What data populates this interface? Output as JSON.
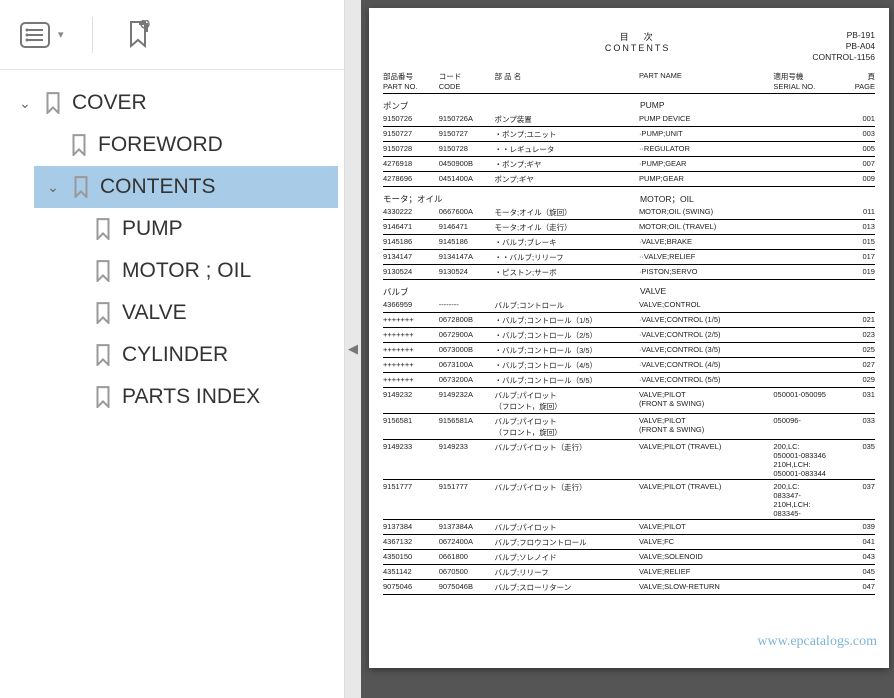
{
  "toolbar": {
    "outline_icon": "outline",
    "bookmark_icon": "bookmark-page"
  },
  "tree": {
    "root": {
      "label": "COVER"
    },
    "children": [
      {
        "label": "FOREWORD"
      },
      {
        "label": "CONTENTS",
        "selected": true,
        "children": [
          {
            "label": "PUMP"
          },
          {
            "label": "MOTOR ; OIL"
          },
          {
            "label": "VALVE"
          },
          {
            "label": "CYLINDER"
          },
          {
            "label": "PARTS INDEX"
          }
        ]
      }
    ]
  },
  "doc": {
    "title_jp": "目　次",
    "title_en": "CONTENTS",
    "codes": [
      "PB-191",
      "PB-A04",
      "CONTROL-1156"
    ],
    "headers": {
      "partno_jp": "部品番号",
      "partno_en": "PART NO.",
      "code_jp": "コード",
      "code_en": "CODE",
      "name_jp": "部 品 名",
      "name_en": "PART NAME",
      "serial_jp": "適用号機",
      "serial_en": "SERIAL NO.",
      "page_jp": "頁",
      "page_en": "PAGE"
    },
    "sections": [
      {
        "head_jp": "ポンプ",
        "head_en": "PUMP",
        "rows": [
          {
            "partno": "9150726",
            "code": "9150726A",
            "name_jp": "ポンプ装置",
            "name_en": "PUMP DEVICE",
            "serial": "",
            "page": "001"
          },
          {
            "partno": "9150727",
            "code": "9150727",
            "name_jp": "・ポンプ;ユニット",
            "name_en": "·PUMP;UNIT",
            "serial": "",
            "page": "003"
          },
          {
            "partno": "9150728",
            "code": "9150728",
            "name_jp": "・・レギュレータ",
            "name_en": "··REGULATOR",
            "serial": "",
            "page": "005"
          },
          {
            "partno": "4276918",
            "code": "0450900B",
            "name_jp": "・ポンプ;ギヤ",
            "name_en": "·PUMP;GEAR",
            "serial": "",
            "page": "007"
          },
          {
            "partno": "4278696",
            "code": "0451400A",
            "name_jp": "ポンプ;ギヤ",
            "name_en": "PUMP;GEAR",
            "serial": "",
            "page": "009"
          }
        ]
      },
      {
        "head_jp": "モータ；オイル",
        "head_en": "MOTOR；OIL",
        "rows": [
          {
            "partno": "4330222",
            "code": "0667600A",
            "name_jp": "モータ;オイル（旋回）",
            "name_en": "MOTOR;OIL (SWING)",
            "serial": "",
            "page": "011"
          },
          {
            "partno": "9146471",
            "code": "9146471",
            "name_jp": "モータ;オイル（走行）",
            "name_en": "MOTOR;OIL (TRAVEL)",
            "serial": "",
            "page": "013"
          },
          {
            "partno": "9145186",
            "code": "9145186",
            "name_jp": "・バルブ;ブレーキ",
            "name_en": "·VALVE;BRAKE",
            "serial": "",
            "page": "015"
          },
          {
            "partno": "9134147",
            "code": "9134147A",
            "name_jp": "・・バルブ;リリーフ",
            "name_en": "··VALVE;RELIEF",
            "serial": "",
            "page": "017"
          },
          {
            "partno": "9130524",
            "code": "9130524",
            "name_jp": "・ピストン;サーボ",
            "name_en": "·PISTON;SERVO",
            "serial": "",
            "page": "019"
          }
        ]
      },
      {
        "head_jp": "バルブ",
        "head_en": "VALVE",
        "rows": [
          {
            "partno": "4366959",
            "code": "--------",
            "name_jp": "バルブ;コントロール",
            "name_en": "VALVE;CONTROL",
            "serial": "",
            "page": ""
          },
          {
            "partno": "+++++++",
            "code": "0672800B",
            "name_jp": "・バルブ;コントロール（1/5）",
            "name_en": "·VALVE;CONTROL (1/5)",
            "serial": "",
            "page": "021"
          },
          {
            "partno": "+++++++",
            "code": "0672900A",
            "name_jp": "・バルブ;コントロール（2/5）",
            "name_en": "·VALVE;CONTROL (2/5)",
            "serial": "",
            "page": "023"
          },
          {
            "partno": "+++++++",
            "code": "0673000B",
            "name_jp": "・バルブ;コントロール（3/5）",
            "name_en": "·VALVE;CONTROL (3/5)",
            "serial": "",
            "page": "025"
          },
          {
            "partno": "+++++++",
            "code": "0673100A",
            "name_jp": "・バルブ;コントロール（4/5）",
            "name_en": "·VALVE;CONTROL (4/5)",
            "serial": "",
            "page": "027"
          },
          {
            "partno": "+++++++",
            "code": "0673200A",
            "name_jp": "・バルブ;コントロール（5/5）",
            "name_en": "·VALVE;CONTROL (5/5)",
            "serial": "",
            "page": "029"
          },
          {
            "partno": "9149232",
            "code": "9149232A",
            "name_jp": "バルブ;パイロット\n（フロント，旋回）",
            "name_en": "VALVE;PILOT\n(FRONT & SWING)",
            "serial": "050001-050095",
            "page": "031",
            "tall": true
          },
          {
            "partno": "9156581",
            "code": "9156581A",
            "name_jp": "バルブ;パイロット\n（フロント，旋回）",
            "name_en": "VALVE;PILOT\n(FRONT & SWING)",
            "serial": "050096-",
            "page": "033",
            "tall": true
          },
          {
            "partno": "9149233",
            "code": "9149233",
            "name_jp": "バルブ;パイロット（走行）",
            "name_en": "VALVE;PILOT (TRAVEL)",
            "serial": "200,LC:\n050001-083346\n210H,LCH:\n050001-083344",
            "page": "035",
            "tall": true
          },
          {
            "partno": "9151777",
            "code": "9151777",
            "name_jp": "バルブ;パイロット（走行）",
            "name_en": "VALVE;PILOT (TRAVEL)",
            "serial": "200,LC:\n083347-\n210H,LCH:\n083345-",
            "page": "037",
            "tall": true
          },
          {
            "partno": "9137384",
            "code": "9137384A",
            "name_jp": "バルブ;パイロット",
            "name_en": "VALVE;PILOT",
            "serial": "",
            "page": "039"
          },
          {
            "partno": "4367132",
            "code": "0672400A",
            "name_jp": "バルブ;フロウコントロール",
            "name_en": "VALVE;FC",
            "serial": "",
            "page": "041"
          },
          {
            "partno": "4350150",
            "code": "0661800",
            "name_jp": "バルブ;ソレノイド",
            "name_en": "VALVE;SOLENOID",
            "serial": "",
            "page": "043"
          },
          {
            "partno": "4351142",
            "code": "0670500",
            "name_jp": "バルブ;リリーフ",
            "name_en": "VALVE;RELIEF",
            "serial": "",
            "page": "045"
          },
          {
            "partno": "9075046",
            "code": "9075046B",
            "name_jp": "バルブ;スローリターン",
            "name_en": "VALVE;SLOW-RETURN",
            "serial": "",
            "page": "047"
          }
        ]
      }
    ],
    "watermark": "www.epcatalogs.com"
  }
}
